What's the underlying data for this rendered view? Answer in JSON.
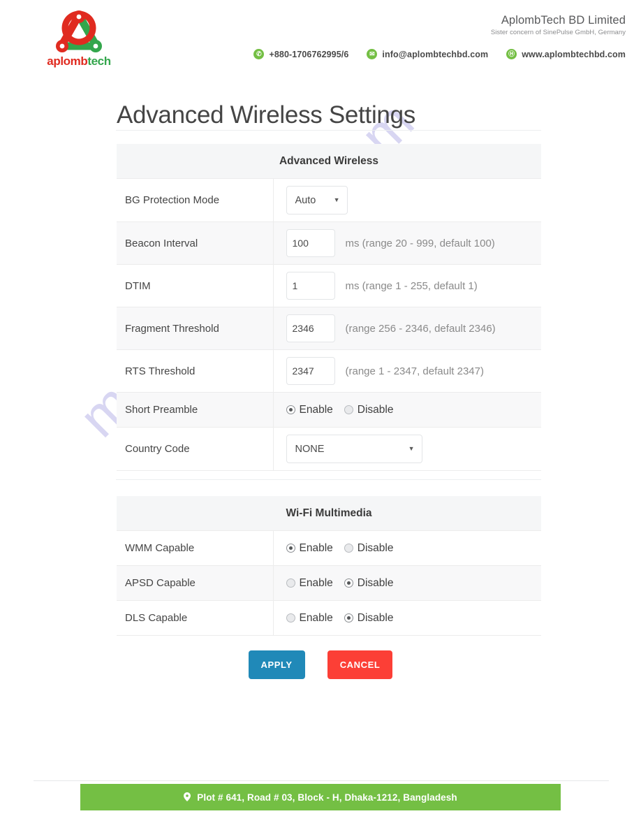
{
  "header": {
    "logo": {
      "text_part1": "aplomb",
      "text_part2": "tech",
      "icon": "network-triangle-logo"
    },
    "company_name": "AplombTech BD Limited",
    "company_sub": "Sister concern of SinePulse GmbH, Germany",
    "contacts": [
      {
        "icon": "phone-icon",
        "glyph": "✆",
        "text": "+880-1706762995/6"
      },
      {
        "icon": "envelope-icon",
        "glyph": "✉",
        "text": "info@aplombtechbd.com"
      },
      {
        "icon": "globe-icon",
        "glyph": "Ⓗ",
        "text": "www.aplombtechbd.com"
      }
    ]
  },
  "page_title": "Advanced Wireless Settings",
  "watermark": "manualshive.com",
  "advanced_wireless": {
    "section_title": "Advanced Wireless",
    "rows": [
      {
        "label": "BG Protection Mode",
        "type": "select",
        "value": "Auto",
        "width": "small"
      },
      {
        "label": "Beacon Interval",
        "type": "text",
        "value": "100",
        "hint": "ms (range 20 - 999, default 100)"
      },
      {
        "label": "DTIM",
        "type": "text",
        "value": "1",
        "hint": "ms (range 1 - 255, default 1)"
      },
      {
        "label": "Fragment Threshold",
        "type": "text",
        "value": "2346",
        "hint": "(range 256 - 2346, default 2346)"
      },
      {
        "label": "RTS Threshold",
        "type": "text",
        "value": "2347",
        "hint": "(range 1 - 2347, default 2347)"
      },
      {
        "label": "Short Preamble",
        "type": "radio",
        "options": [
          "Enable",
          "Disable"
        ],
        "selected": "Enable"
      },
      {
        "label": "Country Code",
        "type": "select",
        "value": "NONE",
        "width": "wide"
      }
    ]
  },
  "wifi_multimedia": {
    "section_title": "Wi-Fi Multimedia",
    "rows": [
      {
        "label": "WMM Capable",
        "type": "radio",
        "options": [
          "Enable",
          "Disable"
        ],
        "selected": "Enable"
      },
      {
        "label": "APSD Capable",
        "type": "radio",
        "options": [
          "Enable",
          "Disable"
        ],
        "selected": "Disable"
      },
      {
        "label": "DLS Capable",
        "type": "radio",
        "options": [
          "Enable",
          "Disable"
        ],
        "selected": "Disable"
      }
    ]
  },
  "buttons": {
    "apply": "APPLY",
    "cancel": "CANCEL"
  },
  "footer": {
    "icon": "map-pin-icon",
    "address": "Plot # 641, Road # 03, Block - H, Dhaka-1212, Bangladesh"
  },
  "colors": {
    "brand_green": "#74bf44",
    "logo_red": "#e02b20",
    "logo_green": "#33a64c",
    "apply_blue": "#2089b8",
    "cancel_red": "#fc3f36",
    "watermark_purple": "#8b86d8"
  }
}
